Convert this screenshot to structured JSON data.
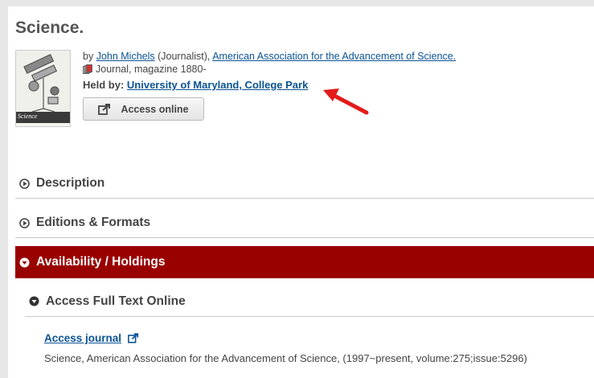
{
  "record": {
    "title": "Science.",
    "by_prefix": "by ",
    "author": "John Michels",
    "author_role": " (Journalist), ",
    "organization": "American Association for the Advancement of Science.",
    "format": "Journal, magazine 1880-",
    "held_by_label": "Held by: ",
    "held_by_value": "University of Maryland, College Park",
    "access_button_label": "Access online",
    "cover_text": "Science"
  },
  "sections": {
    "description": "Description",
    "editions": "Editions & Formats",
    "availability": "Availability / Holdings",
    "full_text": "Access Full Text Online"
  },
  "holding": {
    "link_label": "Access journal",
    "description": "Science, American Association for the Advancement of Science, (1997~present, volume:275;issue:5296)"
  },
  "colors": {
    "accent": "#990000",
    "link": "#0b5394",
    "arrow": "#e31b1b"
  },
  "icons": [
    "book-format-icon",
    "external-link-icon",
    "circle-play-icon",
    "circle-chevron-down-icon",
    "red-arrow-annotation"
  ]
}
